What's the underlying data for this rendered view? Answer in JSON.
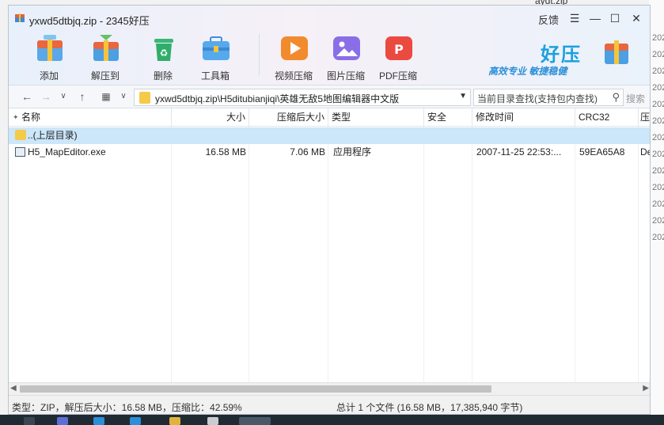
{
  "window": {
    "title": "yxwd5dtbjq.zip - 2345好压",
    "feedback_label": "反馈"
  },
  "background": {
    "top_file": "aydt.zip",
    "right_labels": [
      "202",
      "202",
      "202",
      "202",
      "202",
      "202",
      "202",
      "202",
      "202",
      "202",
      "202",
      "202",
      "202"
    ]
  },
  "toolbar": {
    "items": [
      {
        "label": "添加",
        "icon": "add-box-icon"
      },
      {
        "label": "解压到",
        "icon": "extract-box-icon"
      },
      {
        "label": "删除",
        "icon": "recycle-bin-icon"
      },
      {
        "label": "工具箱",
        "icon": "toolbox-icon"
      },
      {
        "label": "视频压缩",
        "icon": "video-compress-icon"
      },
      {
        "label": "图片压缩",
        "icon": "image-compress-icon"
      },
      {
        "label": "PDF压缩",
        "icon": "pdf-compress-icon"
      }
    ]
  },
  "brand": {
    "name": "好压",
    "slogan": "高效专业  敏捷稳健"
  },
  "navbar": {
    "path": "yxwd5dtbjq.zip\\H5ditubianjiqi\\英雄无敌5地图编辑器中文版",
    "search_placeholder": "当前目录查找(支持包内查找)",
    "search_button": "搜索"
  },
  "columns": [
    "名称",
    "大小",
    "压缩后大小",
    "类型",
    "安全",
    "修改时间",
    "CRC32",
    "压缩"
  ],
  "rows": [
    {
      "name": "..(上层目录)",
      "size": "",
      "packed": "",
      "type": "",
      "safe": "",
      "modified": "",
      "crc": "",
      "method": "",
      "kind": "parent"
    },
    {
      "name": "H5_MapEditor.exe",
      "size": "16.58 MB",
      "packed": "7.06 MB",
      "type": "应用程序",
      "safe": "",
      "modified": "2007-11-25 22:53:...",
      "crc": "59EA65A8",
      "method": "De",
      "kind": "exe"
    }
  ],
  "status": {
    "left": "类型：ZIP，解压后大小：16.58 MB，压缩比：42.59%",
    "right": "总计 1 个文件 (16.58 MB，17,385,940 字节)"
  },
  "colors": {
    "selected_row": "#cce6fa",
    "brand_blue": "#1aa0e0"
  }
}
